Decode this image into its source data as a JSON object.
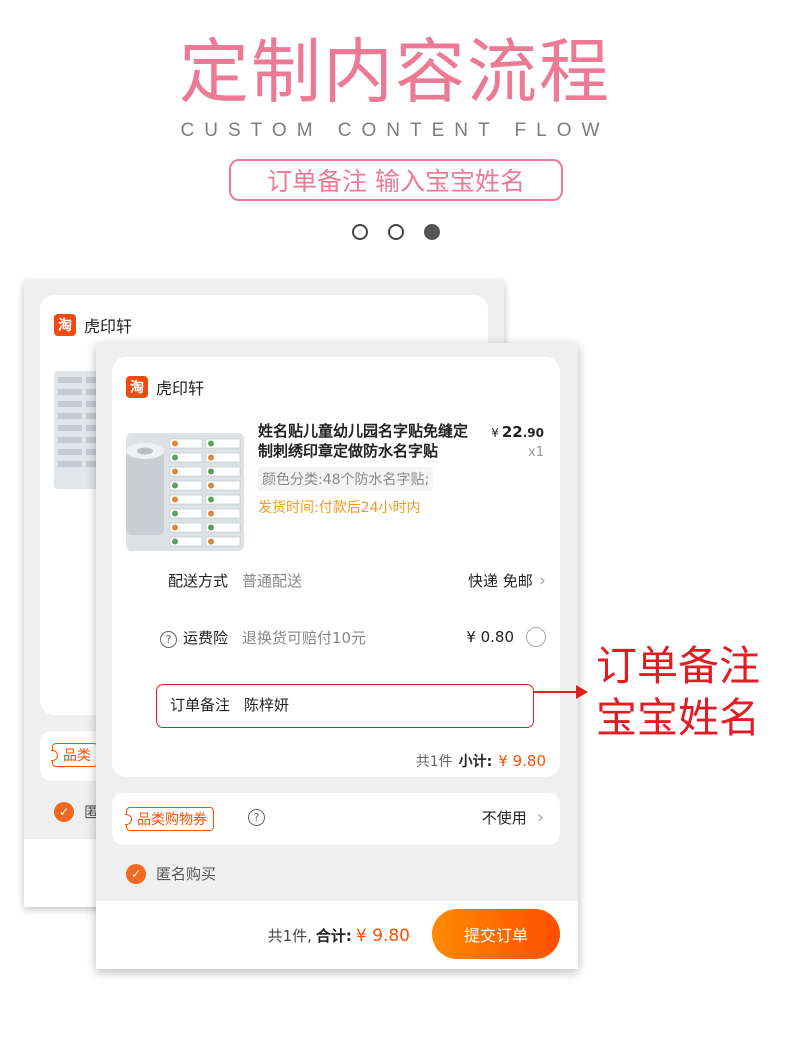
{
  "header": {
    "title": "定制内容流程",
    "subtitle": "CUSTOM CONTENT FLOW",
    "step_label": "订单备注 输入宝宝姓名",
    "active_step": 3,
    "total_steps": 3
  },
  "shop": {
    "icon_char": "淘",
    "name": "虎印轩"
  },
  "product": {
    "title": "姓名贴儿童幼儿园名字贴免缝定制刺绣印章定做防水名字贴",
    "price_symbol": "¥",
    "price_int": "22",
    "price_dec": ".90",
    "qty": "x1",
    "sku": "颜色分类:48个防水名字贴;",
    "ship_time": "发货时间:付款后24小时内"
  },
  "delivery": {
    "label": "配送方式",
    "value": "普通配送",
    "right": "快递 免邮"
  },
  "insurance": {
    "label": "运费险",
    "value": "退换货可赔付10元",
    "price": "¥ 0.80"
  },
  "remark": {
    "label": "订单备注",
    "value": "陈梓妍"
  },
  "subtotal": {
    "count": "共1件",
    "label": "小计:",
    "amount": "¥ 9.80"
  },
  "coupon": {
    "tag": "品类购物券",
    "right": "不使用",
    "fragment": "品类"
  },
  "anonymous": {
    "label": "匿名购买",
    "fragment": "匿"
  },
  "bottom": {
    "count": "共1件,",
    "label": "合计:",
    "amount": "¥ 9.80",
    "submit": "提交订单"
  },
  "annotation": {
    "line1": "订单备注",
    "line2": "宝宝姓名"
  },
  "colors": {
    "pink": "#ec7a95",
    "orange": "#ff5000",
    "red": "#e41b23"
  }
}
